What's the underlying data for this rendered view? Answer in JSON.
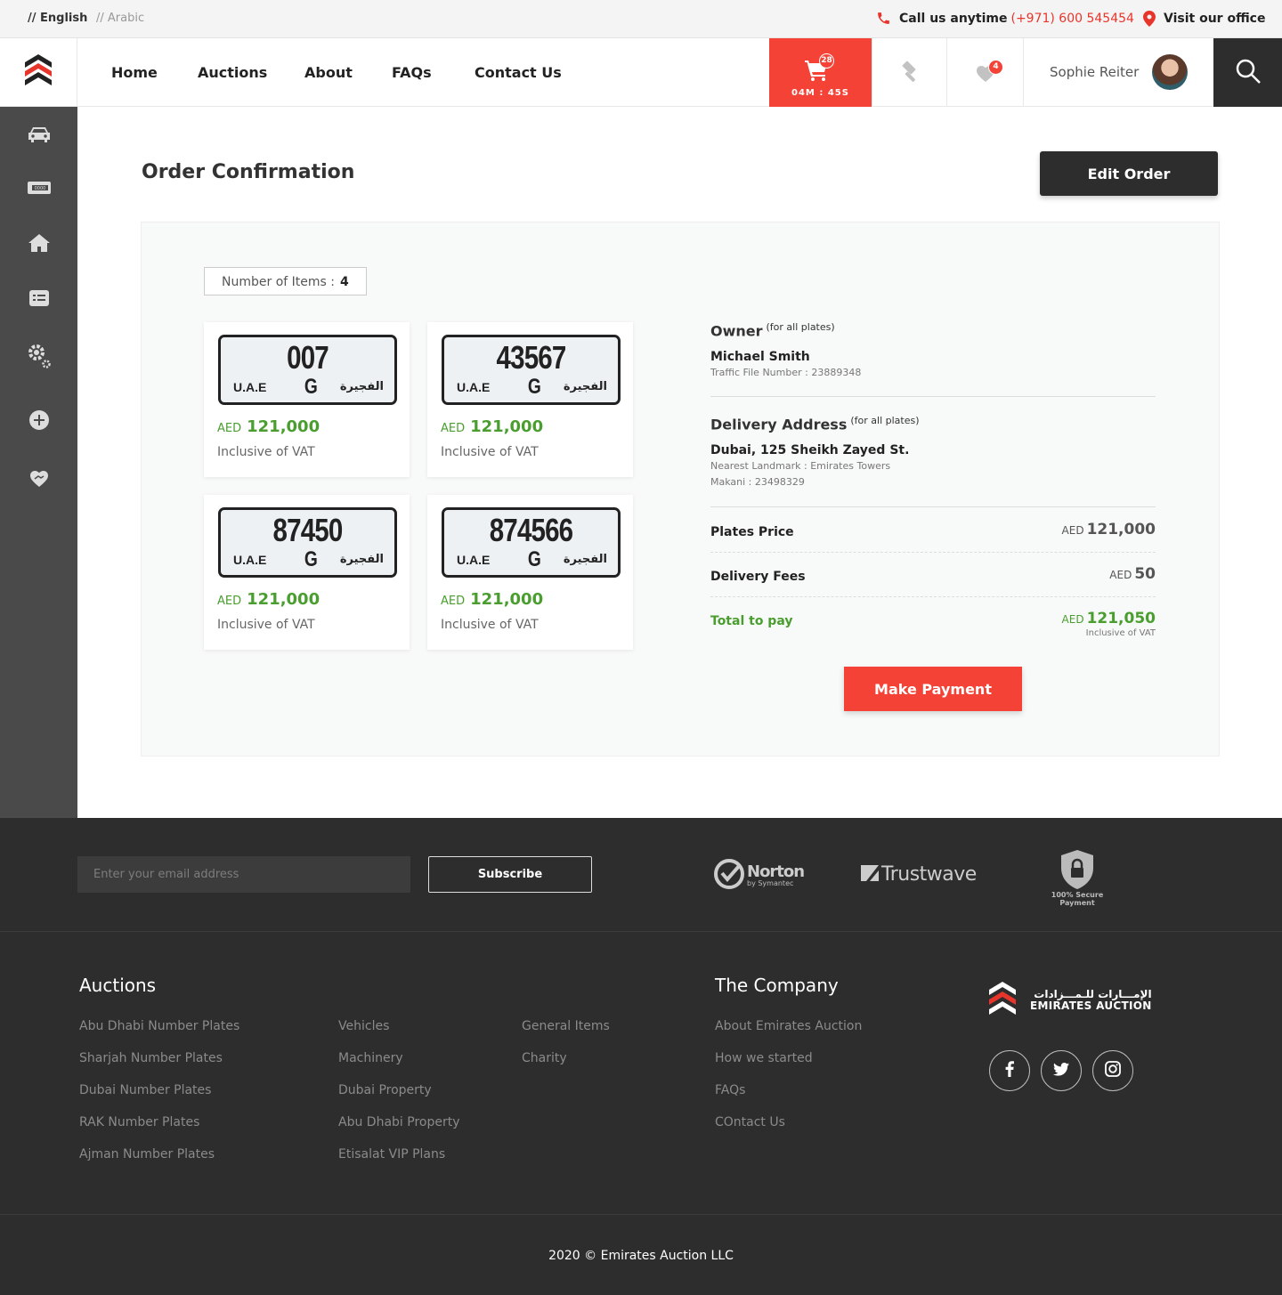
{
  "topbar": {
    "lang_en": "// English",
    "lang_ar": "// Arabic",
    "call_label": "Call us anytime",
    "phone": "(+971) 600 545454",
    "office_label": "Visit our office"
  },
  "nav": {
    "items": [
      "Home",
      "Auctions",
      "About",
      "FAQs",
      "Contact Us"
    ],
    "cart_count": "28",
    "cart_timer": "04M : 45S",
    "fav_count": "4",
    "user_name": "Sophie Reiter"
  },
  "page": {
    "title": "Order Confirmation",
    "edit_button": "Edit Order",
    "items_label": "Number of Items :",
    "items_count": "4"
  },
  "plates": [
    {
      "number": "007",
      "country": "U.A.E",
      "code": "G",
      "emirate": "الفجيرة",
      "currency": "AED",
      "price": "121,000",
      "vat": "Inclusive of VAT"
    },
    {
      "number": "43567",
      "country": "U.A.E",
      "code": "G",
      "emirate": "الفجيرة",
      "currency": "AED",
      "price": "121,000",
      "vat": "Inclusive of VAT"
    },
    {
      "number": "87450",
      "country": "U.A.E",
      "code": "G",
      "emirate": "الفجيرة",
      "currency": "AED",
      "price": "121,000",
      "vat": "Inclusive of VAT"
    },
    {
      "number": "874566",
      "country": "U.A.E",
      "code": "G",
      "emirate": "الفجيرة",
      "currency": "AED",
      "price": "121,000",
      "vat": "Inclusive of VAT"
    }
  ],
  "summary": {
    "owner_title": "Owner",
    "owner_note": "(for all plates)",
    "owner_name": "Michael Smith",
    "traffic_file": "Traffic File Number : 23889348",
    "delivery_title": "Delivery Address",
    "delivery_note": "(for all plates)",
    "address": "Dubai, 125 Sheikh Zayed St.",
    "landmark": "Nearest Landmark : Emirates Towers",
    "makani": "Makani : 23498329",
    "plates_price_label": "Plates Price",
    "plates_price_cur": "AED",
    "plates_price": "121,000",
    "delivery_fees_label": "Delivery Fees",
    "delivery_fees_cur": "AED",
    "delivery_fees": "50",
    "total_label": "Total to pay",
    "total_cur": "AED",
    "total": "121,050",
    "total_vat": "Inclusive of VAT",
    "pay_button": "Make Payment"
  },
  "footer": {
    "email_placeholder": "Enter your email address",
    "subscribe": "Subscribe",
    "norton": "Norton",
    "norton_sub": "by Symantec",
    "trustwave": "Trustwave",
    "secure": "100% Secure Payment",
    "auctions_title": "Auctions",
    "col1": [
      "Abu Dhabi Number Plates",
      "Sharjah Number Plates",
      "Dubai Number Plates",
      "RAK Number Plates",
      "Ajman Number Plates"
    ],
    "col2": [
      "Vehicles",
      "Machinery",
      "Dubai Property",
      "Abu Dhabi Property",
      "Etisalat VIP Plans"
    ],
    "col3": [
      "General Items",
      "Charity"
    ],
    "company_title": "The Company",
    "col4": [
      "About Emirates Auction",
      "How we started",
      "FAQs",
      "COntact Us"
    ],
    "brand_ar": "الإمـــارات للـمـــزادات",
    "brand_en": "EMIRATES AUCTION",
    "copyright": "2020 © Emirates Auction LLC"
  },
  "colors": {
    "accent": "#f44336",
    "dark": "#2d2d2d",
    "price_green": "#4a9e2f",
    "sidebar": "#4a4a4a"
  },
  "icons": [
    "phone-icon",
    "location-pin-icon",
    "logo-icon",
    "cart-icon",
    "gavel-icon",
    "heart-icon",
    "search-icon",
    "car-icon",
    "plate-icon",
    "property-icon",
    "items-icon",
    "settings-icon",
    "add-icon",
    "charity-icon",
    "facebook-icon",
    "twitter-icon",
    "instagram-icon"
  ]
}
